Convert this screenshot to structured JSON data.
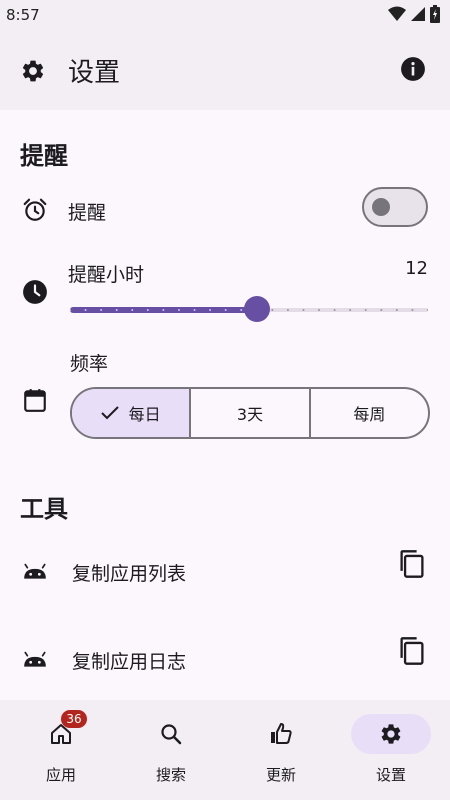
{
  "status_bar": {
    "time": "8:57"
  },
  "app_bar": {
    "title": "设置"
  },
  "sections": {
    "reminders": {
      "header": "提醒",
      "reminder_toggle": {
        "label": "提醒",
        "on": false
      },
      "reminder_hour": {
        "label": "提醒小时",
        "value": "12",
        "min": 0,
        "max": 23,
        "current": 12
      },
      "frequency": {
        "label": "频率",
        "options": [
          "每日",
          "3天",
          "每周"
        ],
        "selected": "每日"
      }
    },
    "tools": {
      "header": "工具",
      "items": [
        {
          "label": "复制应用列表",
          "icon": "android-icon",
          "action_icon": "copy-icon"
        },
        {
          "label": "复制应用日志",
          "icon": "android-icon",
          "action_icon": "copy-icon"
        }
      ]
    }
  },
  "bottom_nav": {
    "items": [
      {
        "label": "应用",
        "icon": "home-icon",
        "badge": "36",
        "active": false
      },
      {
        "label": "搜索",
        "icon": "search-icon",
        "active": false
      },
      {
        "label": "更新",
        "icon": "thumb-up-icon",
        "active": false
      },
      {
        "label": "设置",
        "icon": "settings-icon",
        "active": true
      }
    ]
  },
  "colors": {
    "accent": "#6750a4",
    "selected_container": "#e8def8",
    "badge": "#b3261e"
  }
}
